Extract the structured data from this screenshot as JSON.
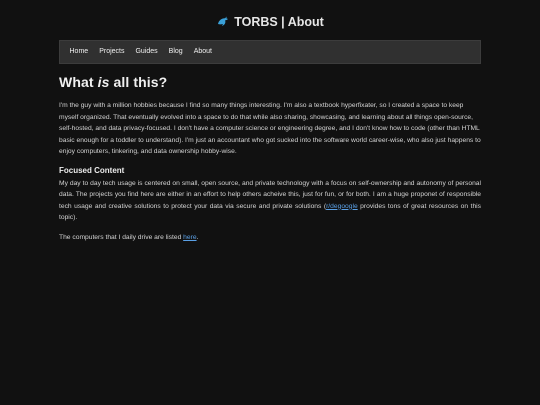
{
  "site": {
    "title": "TORBS | About",
    "logo_icon": "dolphin-icon",
    "accent_color": "#3aa0d8"
  },
  "nav": {
    "items": [
      {
        "label": "Home"
      },
      {
        "label": "Projects"
      },
      {
        "label": "Guides"
      },
      {
        "label": "Blog"
      },
      {
        "label": "About"
      }
    ]
  },
  "main": {
    "heading_pre": "What ",
    "heading_em": "is",
    "heading_post": " all this?",
    "intro": "I'm the guy with a million hobbies because I find so many things interesting. I'm also a textbook hyperfixater, so I created a space to keep myself organized. That eventually evolved into a space to do that while also sharing, showcasing, and learning about all things open-source, self-hosted, and data privacy-focused. I don't have a computer science or engineering degree, and I don't know how to code (other than HTML basic enough for a toddler to understand). I'm just an accountant who got sucked into the software world career-wise, who also just happens to enjoy computers, tinkering, and data ownership hobby-wise.",
    "focused_heading": "Focused Content",
    "focused_text_before": "My day to day tech usage is centered on small, open source, and private technology with a focus on self-ownership and autonomy of personal data. The projects you find here are either in an effort to help others acheive this, just for fun, or for both. I am a huge proponet of responsible tech usage and creative solutions to protect your data via secure and private solutions (",
    "focused_link": "r/degoogle",
    "focused_text_after": " provides tons of great resources on this topic).",
    "computers_before": "The computers that I daily drive are listed ",
    "computers_link": "here",
    "computers_after": "."
  }
}
